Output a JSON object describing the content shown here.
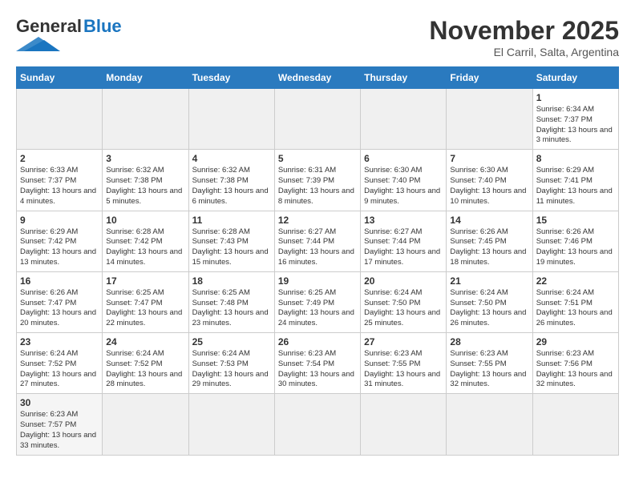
{
  "header": {
    "logo_general": "General",
    "logo_blue": "Blue",
    "month": "November 2025",
    "location": "El Carril, Salta, Argentina"
  },
  "days_of_week": [
    "Sunday",
    "Monday",
    "Tuesday",
    "Wednesday",
    "Thursday",
    "Friday",
    "Saturday"
  ],
  "weeks": [
    [
      {
        "day": "",
        "empty": true
      },
      {
        "day": "",
        "empty": true
      },
      {
        "day": "",
        "empty": true
      },
      {
        "day": "",
        "empty": true
      },
      {
        "day": "",
        "empty": true
      },
      {
        "day": "",
        "empty": true
      },
      {
        "day": "1",
        "sunrise": "6:34 AM",
        "sunset": "7:37 PM",
        "daylight": "13 hours and 3 minutes."
      }
    ],
    [
      {
        "day": "2",
        "sunrise": "6:33 AM",
        "sunset": "7:37 PM",
        "daylight": "13 hours and 4 minutes."
      },
      {
        "day": "3",
        "sunrise": "6:32 AM",
        "sunset": "7:38 PM",
        "daylight": "13 hours and 5 minutes."
      },
      {
        "day": "4",
        "sunrise": "6:32 AM",
        "sunset": "7:38 PM",
        "daylight": "13 hours and 6 minutes."
      },
      {
        "day": "5",
        "sunrise": "6:31 AM",
        "sunset": "7:39 PM",
        "daylight": "13 hours and 8 minutes."
      },
      {
        "day": "6",
        "sunrise": "6:30 AM",
        "sunset": "7:40 PM",
        "daylight": "13 hours and 9 minutes."
      },
      {
        "day": "7",
        "sunrise": "6:30 AM",
        "sunset": "7:40 PM",
        "daylight": "13 hours and 10 minutes."
      },
      {
        "day": "8",
        "sunrise": "6:29 AM",
        "sunset": "7:41 PM",
        "daylight": "13 hours and 11 minutes."
      }
    ],
    [
      {
        "day": "9",
        "sunrise": "6:29 AM",
        "sunset": "7:42 PM",
        "daylight": "13 hours and 13 minutes."
      },
      {
        "day": "10",
        "sunrise": "6:28 AM",
        "sunset": "7:42 PM",
        "daylight": "13 hours and 14 minutes."
      },
      {
        "day": "11",
        "sunrise": "6:28 AM",
        "sunset": "7:43 PM",
        "daylight": "13 hours and 15 minutes."
      },
      {
        "day": "12",
        "sunrise": "6:27 AM",
        "sunset": "7:44 PM",
        "daylight": "13 hours and 16 minutes."
      },
      {
        "day": "13",
        "sunrise": "6:27 AM",
        "sunset": "7:44 PM",
        "daylight": "13 hours and 17 minutes."
      },
      {
        "day": "14",
        "sunrise": "6:26 AM",
        "sunset": "7:45 PM",
        "daylight": "13 hours and 18 minutes."
      },
      {
        "day": "15",
        "sunrise": "6:26 AM",
        "sunset": "7:46 PM",
        "daylight": "13 hours and 19 minutes."
      }
    ],
    [
      {
        "day": "16",
        "sunrise": "6:26 AM",
        "sunset": "7:47 PM",
        "daylight": "13 hours and 20 minutes."
      },
      {
        "day": "17",
        "sunrise": "6:25 AM",
        "sunset": "7:47 PM",
        "daylight": "13 hours and 22 minutes."
      },
      {
        "day": "18",
        "sunrise": "6:25 AM",
        "sunset": "7:48 PM",
        "daylight": "13 hours and 23 minutes."
      },
      {
        "day": "19",
        "sunrise": "6:25 AM",
        "sunset": "7:49 PM",
        "daylight": "13 hours and 24 minutes."
      },
      {
        "day": "20",
        "sunrise": "6:24 AM",
        "sunset": "7:50 PM",
        "daylight": "13 hours and 25 minutes."
      },
      {
        "day": "21",
        "sunrise": "6:24 AM",
        "sunset": "7:50 PM",
        "daylight": "13 hours and 26 minutes."
      },
      {
        "day": "22",
        "sunrise": "6:24 AM",
        "sunset": "7:51 PM",
        "daylight": "13 hours and 26 minutes."
      }
    ],
    [
      {
        "day": "23",
        "sunrise": "6:24 AM",
        "sunset": "7:52 PM",
        "daylight": "13 hours and 27 minutes."
      },
      {
        "day": "24",
        "sunrise": "6:24 AM",
        "sunset": "7:52 PM",
        "daylight": "13 hours and 28 minutes."
      },
      {
        "day": "25",
        "sunrise": "6:24 AM",
        "sunset": "7:53 PM",
        "daylight": "13 hours and 29 minutes."
      },
      {
        "day": "26",
        "sunrise": "6:23 AM",
        "sunset": "7:54 PM",
        "daylight": "13 hours and 30 minutes."
      },
      {
        "day": "27",
        "sunrise": "6:23 AM",
        "sunset": "7:55 PM",
        "daylight": "13 hours and 31 minutes."
      },
      {
        "day": "28",
        "sunrise": "6:23 AM",
        "sunset": "7:55 PM",
        "daylight": "13 hours and 32 minutes."
      },
      {
        "day": "29",
        "sunrise": "6:23 AM",
        "sunset": "7:56 PM",
        "daylight": "13 hours and 32 minutes."
      }
    ],
    [
      {
        "day": "30",
        "sunrise": "6:23 AM",
        "sunset": "7:57 PM",
        "daylight": "13 hours and 33 minutes."
      },
      {
        "day": "",
        "empty": true
      },
      {
        "day": "",
        "empty": true
      },
      {
        "day": "",
        "empty": true
      },
      {
        "day": "",
        "empty": true
      },
      {
        "day": "",
        "empty": true
      },
      {
        "day": "",
        "empty": true
      }
    ]
  ]
}
